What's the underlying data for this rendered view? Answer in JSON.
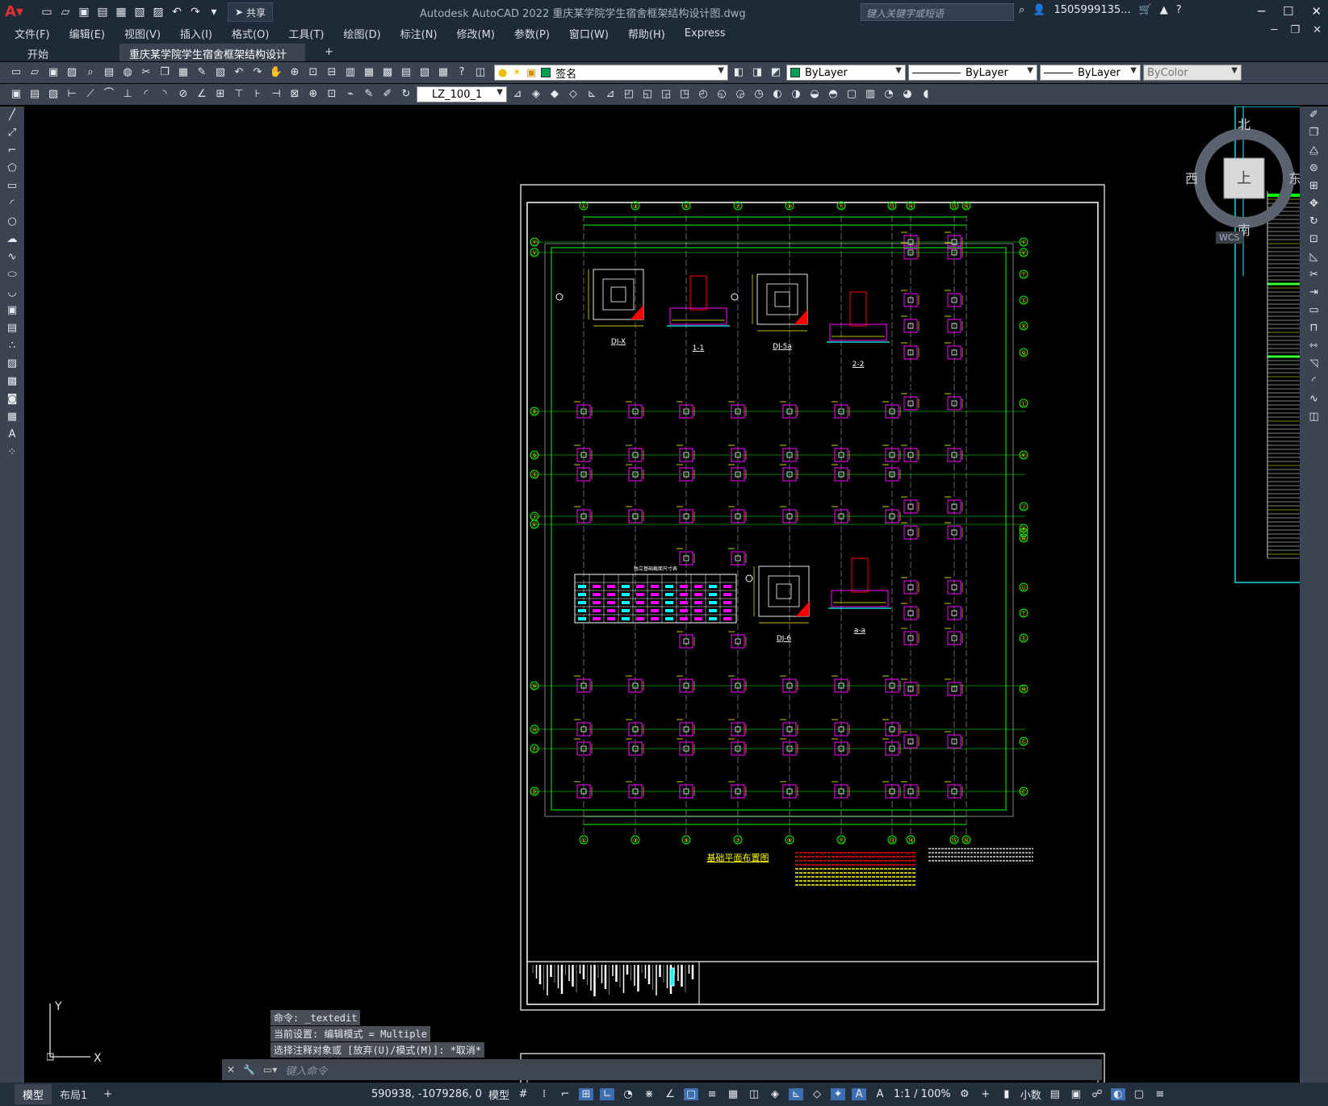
{
  "title_bar": {
    "app_title": "Autodesk AutoCAD 2022    重庆某学院学生宿舍框架结构设计图.dwg",
    "share_label": "共享",
    "search_placeholder": "键入关键字或短语",
    "user": "1505999135...",
    "help": "?"
  },
  "menu": {
    "items": [
      "文件(F)",
      "编辑(E)",
      "视图(V)",
      "插入(I)",
      "格式(O)",
      "工具(T)",
      "绘图(D)",
      "标注(N)",
      "修改(M)",
      "参数(P)",
      "窗口(W)",
      "帮助(H)",
      "Express"
    ]
  },
  "tabs": {
    "start": "开始",
    "drawing": "重庆某学院学生宿舍框架结构设计图*",
    "close": "×",
    "add": "+"
  },
  "toolbar": {
    "layer_name": "签名",
    "color": "ByLayer",
    "linetype": "ByLayer",
    "lineweight": "ByLayer",
    "plotstyle": "ByColor",
    "dimstyle": "LZ_100_1"
  },
  "viewcube": {
    "north": "北",
    "south": "南",
    "east": "东",
    "west": "西",
    "top": "上",
    "wcs": "WCS"
  },
  "drawing": {
    "detail_labels": [
      "DJ-X",
      "1-1",
      "DJ-5a",
      "2-2",
      "DJ-6",
      "a-a"
    ],
    "plan_title": "基础平面布置图",
    "table_title": "独立基础截面尺寸表",
    "axis_numbers": [
      "①",
      "③",
      "⑤",
      "⑦",
      "⑨",
      "⑪",
      "⑬",
      "⑭",
      "⑮",
      "⑯"
    ],
    "axis_letters_left": [
      "Ⓨ",
      "Ⓥ",
      "Ⓡ",
      "Ⓠ",
      "Ⓢ",
      "Ⓙ",
      "Ⓚ",
      "Ⓝ",
      "Ⓗ",
      "Ⓕ",
      "Ⓓ"
    ],
    "axis_letters_right": [
      "Ⓨ",
      "Ⓥ",
      "Ⓣ",
      "Ⓢ",
      "Ⓡ",
      "Ⓠ",
      "Ⓛ",
      "Ⓚ",
      "Ⓙ",
      "Ⓘ",
      "Ⓧ",
      "Ⓦ",
      "Ⓤ",
      "Ⓣ",
      "Ⓢ",
      "Ⓜ",
      "Ⓖ",
      "Ⓒ"
    ]
  },
  "command": {
    "history": [
      "命令: _textedit",
      "当前设置: 编辑模式 = Multiple",
      "选择注释对象或 [放弃(U)/模式(M)]: *取消*"
    ],
    "input_placeholder": "键入命令"
  },
  "ucs": {
    "x": "X",
    "y": "Y"
  },
  "status": {
    "model_tab": "模型",
    "layout_tab": "布局1",
    "add": "+",
    "coords": "590938, -1079286, 0",
    "model": "模型",
    "scale": "1:1 / 100%",
    "units": "小数"
  }
}
